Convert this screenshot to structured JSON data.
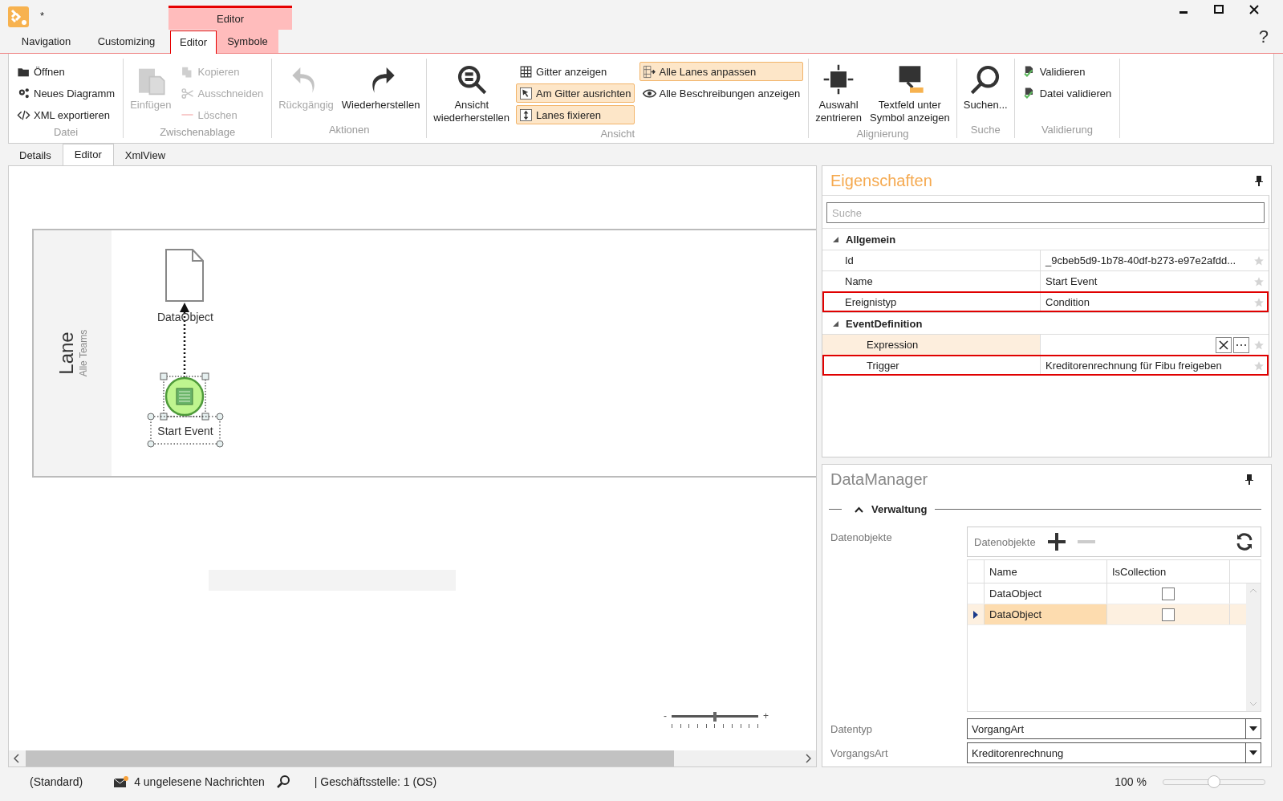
{
  "window": {
    "title": "*",
    "context_tab": "Editor",
    "help": "?"
  },
  "ribbon_tabs": [
    {
      "label": "Navigation",
      "selected": false,
      "contextual": false
    },
    {
      "label": "Customizing",
      "selected": false,
      "contextual": false
    },
    {
      "label": "Editor",
      "selected": true,
      "contextual": true
    },
    {
      "label": "Symbole",
      "selected": false,
      "contextual": true
    }
  ],
  "ribbon_groups": [
    {
      "label": "Datei",
      "columns": [
        [
          {
            "label": "Öffnen",
            "kind": "small",
            "disabled": false,
            "toggled": false
          },
          {
            "label": "Neues Diagramm",
            "kind": "small",
            "disabled": false,
            "toggled": false
          },
          {
            "label": "XML exportieren",
            "kind": "small",
            "disabled": false,
            "toggled": false
          }
        ]
      ]
    },
    {
      "label": "Zwischenablage",
      "columns": [
        [
          {
            "label": "Einfügen",
            "kind": "large",
            "disabled": true,
            "toggled": false
          }
        ],
        [
          {
            "label": "Kopieren",
            "kind": "small",
            "disabled": true,
            "toggled": false
          },
          {
            "label": "Ausschneiden",
            "kind": "small",
            "disabled": true,
            "toggled": false
          },
          {
            "label": "Löschen",
            "kind": "small",
            "disabled": true,
            "toggled": false
          }
        ]
      ]
    },
    {
      "label": "Aktionen",
      "columns": [
        [
          {
            "label": "Rückgängig",
            "kind": "large",
            "disabled": true,
            "toggled": false
          }
        ],
        [
          {
            "label": "Wiederherstellen",
            "kind": "large",
            "disabled": false,
            "toggled": false
          }
        ]
      ]
    },
    {
      "label": "Ansicht",
      "columns": [
        [
          {
            "label": "Ansicht\nwiederherstellen",
            "kind": "large",
            "disabled": false,
            "toggled": false
          }
        ],
        [
          {
            "label": "Gitter anzeigen",
            "kind": "small",
            "disabled": false,
            "toggled": false
          },
          {
            "label": "Am Gitter ausrichten",
            "kind": "small",
            "disabled": false,
            "toggled": true
          },
          {
            "label": "Lanes fixieren",
            "kind": "small",
            "disabled": false,
            "toggled": true
          }
        ],
        [
          {
            "label": "Alle Lanes anpassen",
            "kind": "small",
            "disabled": false,
            "toggled": true
          },
          {
            "label": "Alle Beschreibungen anzeigen",
            "kind": "small",
            "disabled": false,
            "toggled": false
          }
        ]
      ]
    },
    {
      "label": "Alignierung",
      "columns": [
        [
          {
            "label": "Auswahl\nzentrieren",
            "kind": "large",
            "disabled": false,
            "toggled": false
          }
        ],
        [
          {
            "label": "Textfeld unter\nSymbol anzeigen",
            "kind": "large",
            "disabled": false,
            "toggled": false
          }
        ]
      ]
    },
    {
      "label": "Suche",
      "columns": [
        [
          {
            "label": "Suchen...",
            "kind": "large",
            "disabled": false,
            "toggled": false
          }
        ]
      ]
    },
    {
      "label": "Validierung",
      "columns": [
        [
          {
            "label": "Validieren",
            "kind": "small",
            "disabled": false,
            "toggled": false
          },
          {
            "label": "Datei validieren",
            "kind": "small",
            "disabled": false,
            "toggled": false
          }
        ]
      ]
    }
  ],
  "document_tabs": [
    {
      "label": "Details",
      "selected": false
    },
    {
      "label": "Editor",
      "selected": true
    },
    {
      "label": "XmlView",
      "selected": false
    }
  ],
  "diagram": {
    "lane": {
      "name": "Lane",
      "subtitle": "Alle Teams"
    },
    "nodes": [
      {
        "kind": "data_object",
        "label": "DataObject",
        "selected": false
      },
      {
        "kind": "start_event",
        "label": "Start Event",
        "selected": true
      }
    ],
    "zoom": {
      "level": 0.5,
      "minus_label": "-",
      "plus_label": "+"
    }
  },
  "properties": {
    "title": "Eigenschaften",
    "search": {
      "placeholder": "Suche"
    },
    "categories": [
      {
        "name": "Allgemein",
        "expanded": true,
        "rows": [
          {
            "name": "Id",
            "value": "_9cbeb5d9-1b78-40df-b273-e97e2afdd...",
            "kind": "text",
            "marked": false,
            "focused": false,
            "favorite": false
          },
          {
            "name": "Name",
            "value": "Start Event",
            "kind": "text",
            "marked": false,
            "focused": false,
            "favorite": false
          },
          {
            "name": "Ereignistyp",
            "value": "Condition",
            "kind": "text",
            "marked": true,
            "focused": false,
            "favorite": false
          }
        ]
      },
      {
        "name": "EventDefinition",
        "expanded": true,
        "rows": [
          {
            "name": "Expression",
            "kind": "editor",
            "marked": false,
            "focused": true,
            "favorite": false
          },
          {
            "name": "Trigger",
            "value": "Kreditorenrechnung für Fibu freigeben",
            "kind": "text",
            "marked": true,
            "focused": false,
            "favorite": false
          }
        ]
      }
    ]
  },
  "data_manager": {
    "title": "DataManager",
    "section": {
      "title": "Verwaltung",
      "expanded": true
    },
    "objects_label": "Datenobjekte",
    "grid": {
      "toolbar_label": "Datenobjekte",
      "columns": [
        "Name",
        "IsCollection"
      ],
      "rows": [
        {
          "name": "DataObject",
          "is_collection": false,
          "selected": false
        },
        {
          "name": "DataObject",
          "is_collection": false,
          "selected": true
        }
      ]
    },
    "fields": [
      {
        "label": "Datentyp",
        "value": "VorgangArt"
      },
      {
        "label": "VorgangsArt",
        "value": "Kreditorenrechnung"
      }
    ]
  },
  "status_bar": {
    "layout": "(Standard)",
    "messages": "4 ungelesene Nachrichten",
    "branch": "| Geschäftsstelle: 1 (OS)",
    "zoom": "100 %",
    "zoom_slider": {
      "level": 0.5
    }
  }
}
